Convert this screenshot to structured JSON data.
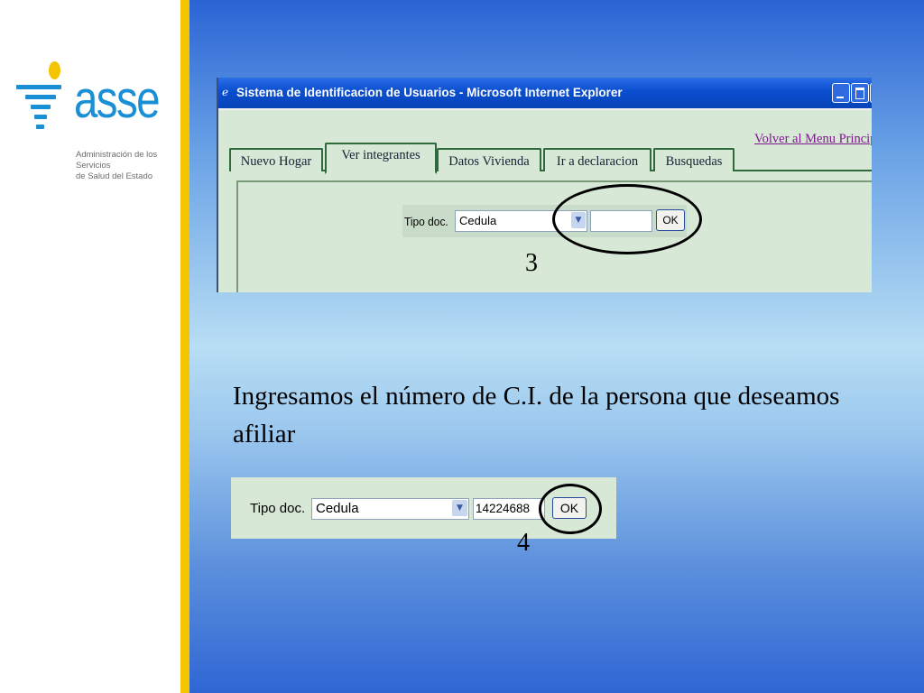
{
  "logo": {
    "name": "asse",
    "subtitle_line1": "Administración de los Servicios",
    "subtitle_line2": "de Salud del Estado",
    "colors": {
      "blue": "#1a8fd6",
      "yellow": "#f5c400"
    }
  },
  "ie_window": {
    "title": "Sistema de Identificacion de Usuarios - Microsoft Internet Explorer",
    "menu_link": "Volver al Menu Principal",
    "tabs": [
      {
        "label": "Nuevo Hogar",
        "active": false
      },
      {
        "label": "Ver integrantes",
        "active": true
      },
      {
        "label": "Datos Vivienda",
        "active": false
      },
      {
        "label": "Ir a declaracion",
        "active": false
      },
      {
        "label": "Busquedas",
        "active": false
      }
    ],
    "form": {
      "label": "Tipo doc.",
      "select_value": "Cedula",
      "input_value": "",
      "button": "OK"
    }
  },
  "steps": {
    "step3": "3",
    "step4": "4"
  },
  "caption": "Ingresamos el número de C.I. de la persona que deseamos afiliar",
  "form_filled": {
    "label": "Tipo doc.",
    "select_value": "Cedula",
    "input_value": "14224688",
    "button": "OK"
  }
}
